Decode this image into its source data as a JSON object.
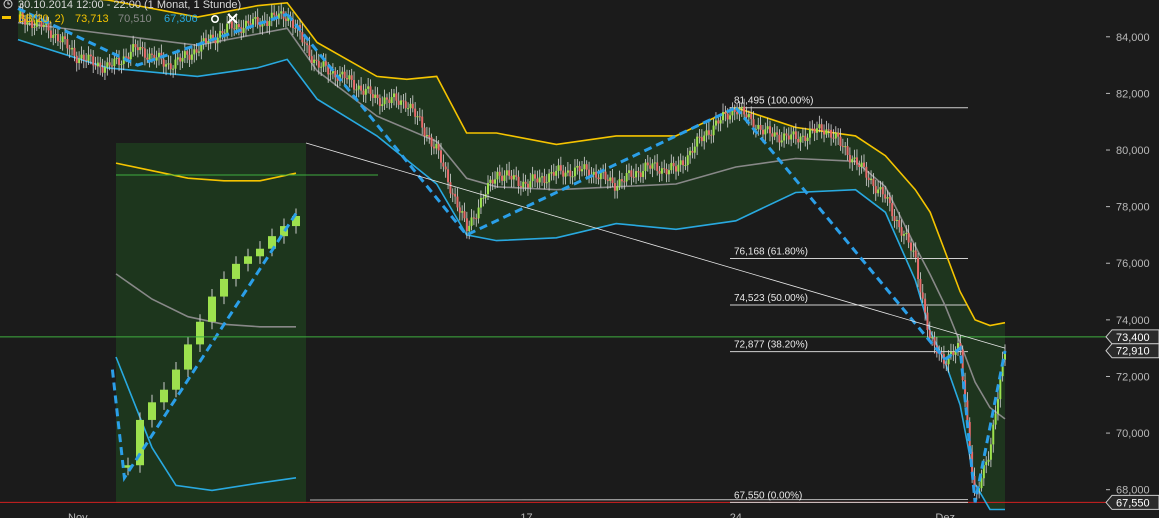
{
  "header": {
    "range_text": "30.10.2014 12:00 - 22:00 (1 Monat, 1 Stunde)",
    "indicator_name": "BB(20, 2)",
    "bb_upper": "73,713",
    "bb_middle": "70,510",
    "bb_lower": "67,306",
    "settings_icon": "settings-icon",
    "close_icon": "close-icon"
  },
  "colors": {
    "background": "#1b1b1b",
    "band_upper": "#f5c400",
    "band_lower": "#29a9e0",
    "band_middle": "#888888",
    "band_fill": "#1e3a1e",
    "candle_up": "#9de14e",
    "candle_down": "#e86b6b",
    "trend_dash": "#2b9fe8",
    "level_green": "#3fae3f",
    "level_red": "#d22020",
    "price_tag_bg": "#2a2a2a"
  },
  "chart_data": {
    "type": "candlestick",
    "y_axis": {
      "ylim": [
        67000,
        85300
      ],
      "tick_values": [
        68000,
        70000,
        72000,
        74000,
        76000,
        78000,
        80000,
        82000,
        84000
      ],
      "tick_labels": [
        "68,000",
        "70,000",
        "72,000",
        "74,000",
        "76,000",
        "78,000",
        "80,000",
        "82,000",
        "84,000"
      ]
    },
    "x_axis": {
      "tick_labels": [
        "Nov",
        "17",
        "24",
        "Dez"
      ],
      "tick_positions_index": [
        2,
        17,
        24,
        31
      ]
    },
    "x_range_index": [
      0,
      33
    ],
    "price_path": [
      [
        0,
        84700
      ],
      [
        1,
        84300
      ],
      [
        2,
        83300
      ],
      [
        3,
        82900
      ],
      [
        4,
        83600
      ],
      [
        5,
        83000
      ],
      [
        5.5,
        83200
      ],
      [
        6,
        83600
      ],
      [
        7,
        84300
      ],
      [
        8,
        84500
      ],
      [
        9,
        84800
      ],
      [
        10,
        83000
      ],
      [
        11,
        82500
      ],
      [
        12,
        81800
      ],
      [
        13,
        81700
      ],
      [
        14,
        80000
      ],
      [
        15,
        77200
      ],
      [
        16,
        79200
      ],
      [
        17,
        78800
      ],
      [
        18,
        79200
      ],
      [
        19,
        79300
      ],
      [
        20,
        78800
      ],
      [
        21,
        79400
      ],
      [
        22,
        79300
      ],
      [
        23,
        80600
      ],
      [
        24,
        81495
      ],
      [
        25,
        80600
      ],
      [
        26,
        80400
      ],
      [
        27,
        80800
      ],
      [
        28,
        79600
      ],
      [
        29,
        78300
      ],
      [
        30,
        76200
      ],
      [
        30.5,
        73200
      ],
      [
        31,
        72600
      ],
      [
        31.5,
        73000
      ],
      [
        32,
        67550
      ],
      [
        32.5,
        69500
      ],
      [
        33,
        72900
      ]
    ],
    "bollinger": {
      "upper": [
        [
          0,
          85600
        ],
        [
          3,
          85300
        ],
        [
          6,
          84700
        ],
        [
          8,
          85100
        ],
        [
          9,
          85200
        ],
        [
          10,
          83800
        ],
        [
          12,
          82600
        ],
        [
          13,
          82500
        ],
        [
          14,
          82600
        ],
        [
          15,
          80600
        ],
        [
          16,
          80600
        ],
        [
          18,
          80200
        ],
        [
          20,
          80500
        ],
        [
          22,
          80500
        ],
        [
          24,
          81500
        ],
        [
          26,
          80800
        ],
        [
          28,
          80500
        ],
        [
          29,
          79800
        ],
        [
          30,
          78600
        ],
        [
          30.5,
          77800
        ],
        [
          31,
          76400
        ],
        [
          31.5,
          75000
        ],
        [
          32,
          74000
        ],
        [
          32.5,
          73800
        ],
        [
          33,
          73900
        ]
      ],
      "middle": [
        [
          0,
          84500
        ],
        [
          3,
          84100
        ],
        [
          6,
          83700
        ],
        [
          8,
          84100
        ],
        [
          9,
          84300
        ],
        [
          10,
          82800
        ],
        [
          12,
          81200
        ],
        [
          14,
          80300
        ],
        [
          15,
          79000
        ],
        [
          16,
          78700
        ],
        [
          18,
          78600
        ],
        [
          20,
          78700
        ],
        [
          22,
          78800
        ],
        [
          24,
          79400
        ],
        [
          26,
          79700
        ],
        [
          28,
          79600
        ],
        [
          29,
          78700
        ],
        [
          30,
          76600
        ],
        [
          30.5,
          75600
        ],
        [
          31,
          74500
        ],
        [
          31.5,
          73200
        ],
        [
          32,
          71800
        ],
        [
          32.5,
          70900
        ],
        [
          33,
          70500
        ]
      ],
      "lower": [
        [
          0,
          83900
        ],
        [
          3,
          82900
        ],
        [
          6,
          82600
        ],
        [
          8,
          82900
        ],
        [
          9,
          83200
        ],
        [
          10,
          81800
        ],
        [
          12,
          80500
        ],
        [
          14,
          78800
        ],
        [
          15,
          77000
        ],
        [
          16,
          76800
        ],
        [
          18,
          76900
        ],
        [
          20,
          77400
        ],
        [
          22,
          77200
        ],
        [
          24,
          77500
        ],
        [
          26,
          78500
        ],
        [
          28,
          78600
        ],
        [
          29,
          77800
        ],
        [
          30,
          75400
        ],
        [
          30.5,
          73600
        ],
        [
          31,
          72500
        ],
        [
          31.5,
          71000
        ],
        [
          32,
          68200
        ],
        [
          32.5,
          67300
        ],
        [
          33,
          67300
        ]
      ]
    },
    "fibonacci": [
      {
        "value": 81495,
        "label": "81,495 (100.00%)"
      },
      {
        "value": 76168,
        "label": "76,168 (61.80%)"
      },
      {
        "value": 74523,
        "label": "74,523 (50.00%)"
      },
      {
        "value": 72877,
        "label": "72,877 (38.20%)"
      },
      {
        "value": 67550,
        "label": "67,550 (0.00%)"
      }
    ],
    "horizontal_levels": [
      {
        "value": 73400,
        "label": "73,400",
        "color": "#3fae3f"
      },
      {
        "value": 67550,
        "label": "67,550",
        "color": "#d22020"
      }
    ],
    "last_price": {
      "value": 72910,
      "label": "72,910"
    },
    "trend_lines_dashed": [
      [
        [
          0,
          85000
        ],
        [
          4,
          83000
        ],
        [
          9,
          84800
        ]
      ],
      [
        [
          9,
          84800
        ],
        [
          15,
          77000
        ],
        [
          24,
          81495
        ]
      ],
      [
        [
          24,
          81495
        ],
        [
          31,
          72600
        ]
      ],
      [
        [
          31,
          72600
        ],
        [
          31.5,
          73000
        ],
        [
          32,
          67550
        ],
        [
          33,
          72900
        ]
      ]
    ],
    "trend_line_thin": [
      [
        9,
        79500
      ],
      [
        33,
        73000
      ]
    ],
    "inset": {
      "source_index_range": [
        31.5,
        33
      ],
      "price_path": [
        [
          0,
          67900
        ],
        [
          1,
          68000
        ],
        [
          2,
          69800
        ],
        [
          3,
          70500
        ],
        [
          4,
          71000
        ],
        [
          5,
          71800
        ],
        [
          6,
          72800
        ],
        [
          7,
          73700
        ],
        [
          8,
          74700
        ],
        [
          9,
          75400
        ],
        [
          10,
          76000
        ],
        [
          11,
          76300
        ],
        [
          12,
          76600
        ],
        [
          13,
          77100
        ],
        [
          14,
          77500
        ],
        [
          15,
          77900
        ]
      ],
      "band_upper": [
        [
          0,
          80000
        ],
        [
          3,
          79700
        ],
        [
          6,
          79400
        ],
        [
          9,
          79300
        ],
        [
          12,
          79300
        ],
        [
          15,
          79600
        ]
      ],
      "band_middle": [
        [
          0,
          75600
        ],
        [
          3,
          74600
        ],
        [
          6,
          73900
        ],
        [
          9,
          73600
        ],
        [
          12,
          73500
        ],
        [
          15,
          73500
        ]
      ],
      "band_lower": [
        [
          0,
          72300
        ],
        [
          3,
          68700
        ],
        [
          5,
          67200
        ],
        [
          8,
          67000
        ],
        [
          12,
          67300
        ],
        [
          15,
          67500
        ]
      ]
    }
  }
}
